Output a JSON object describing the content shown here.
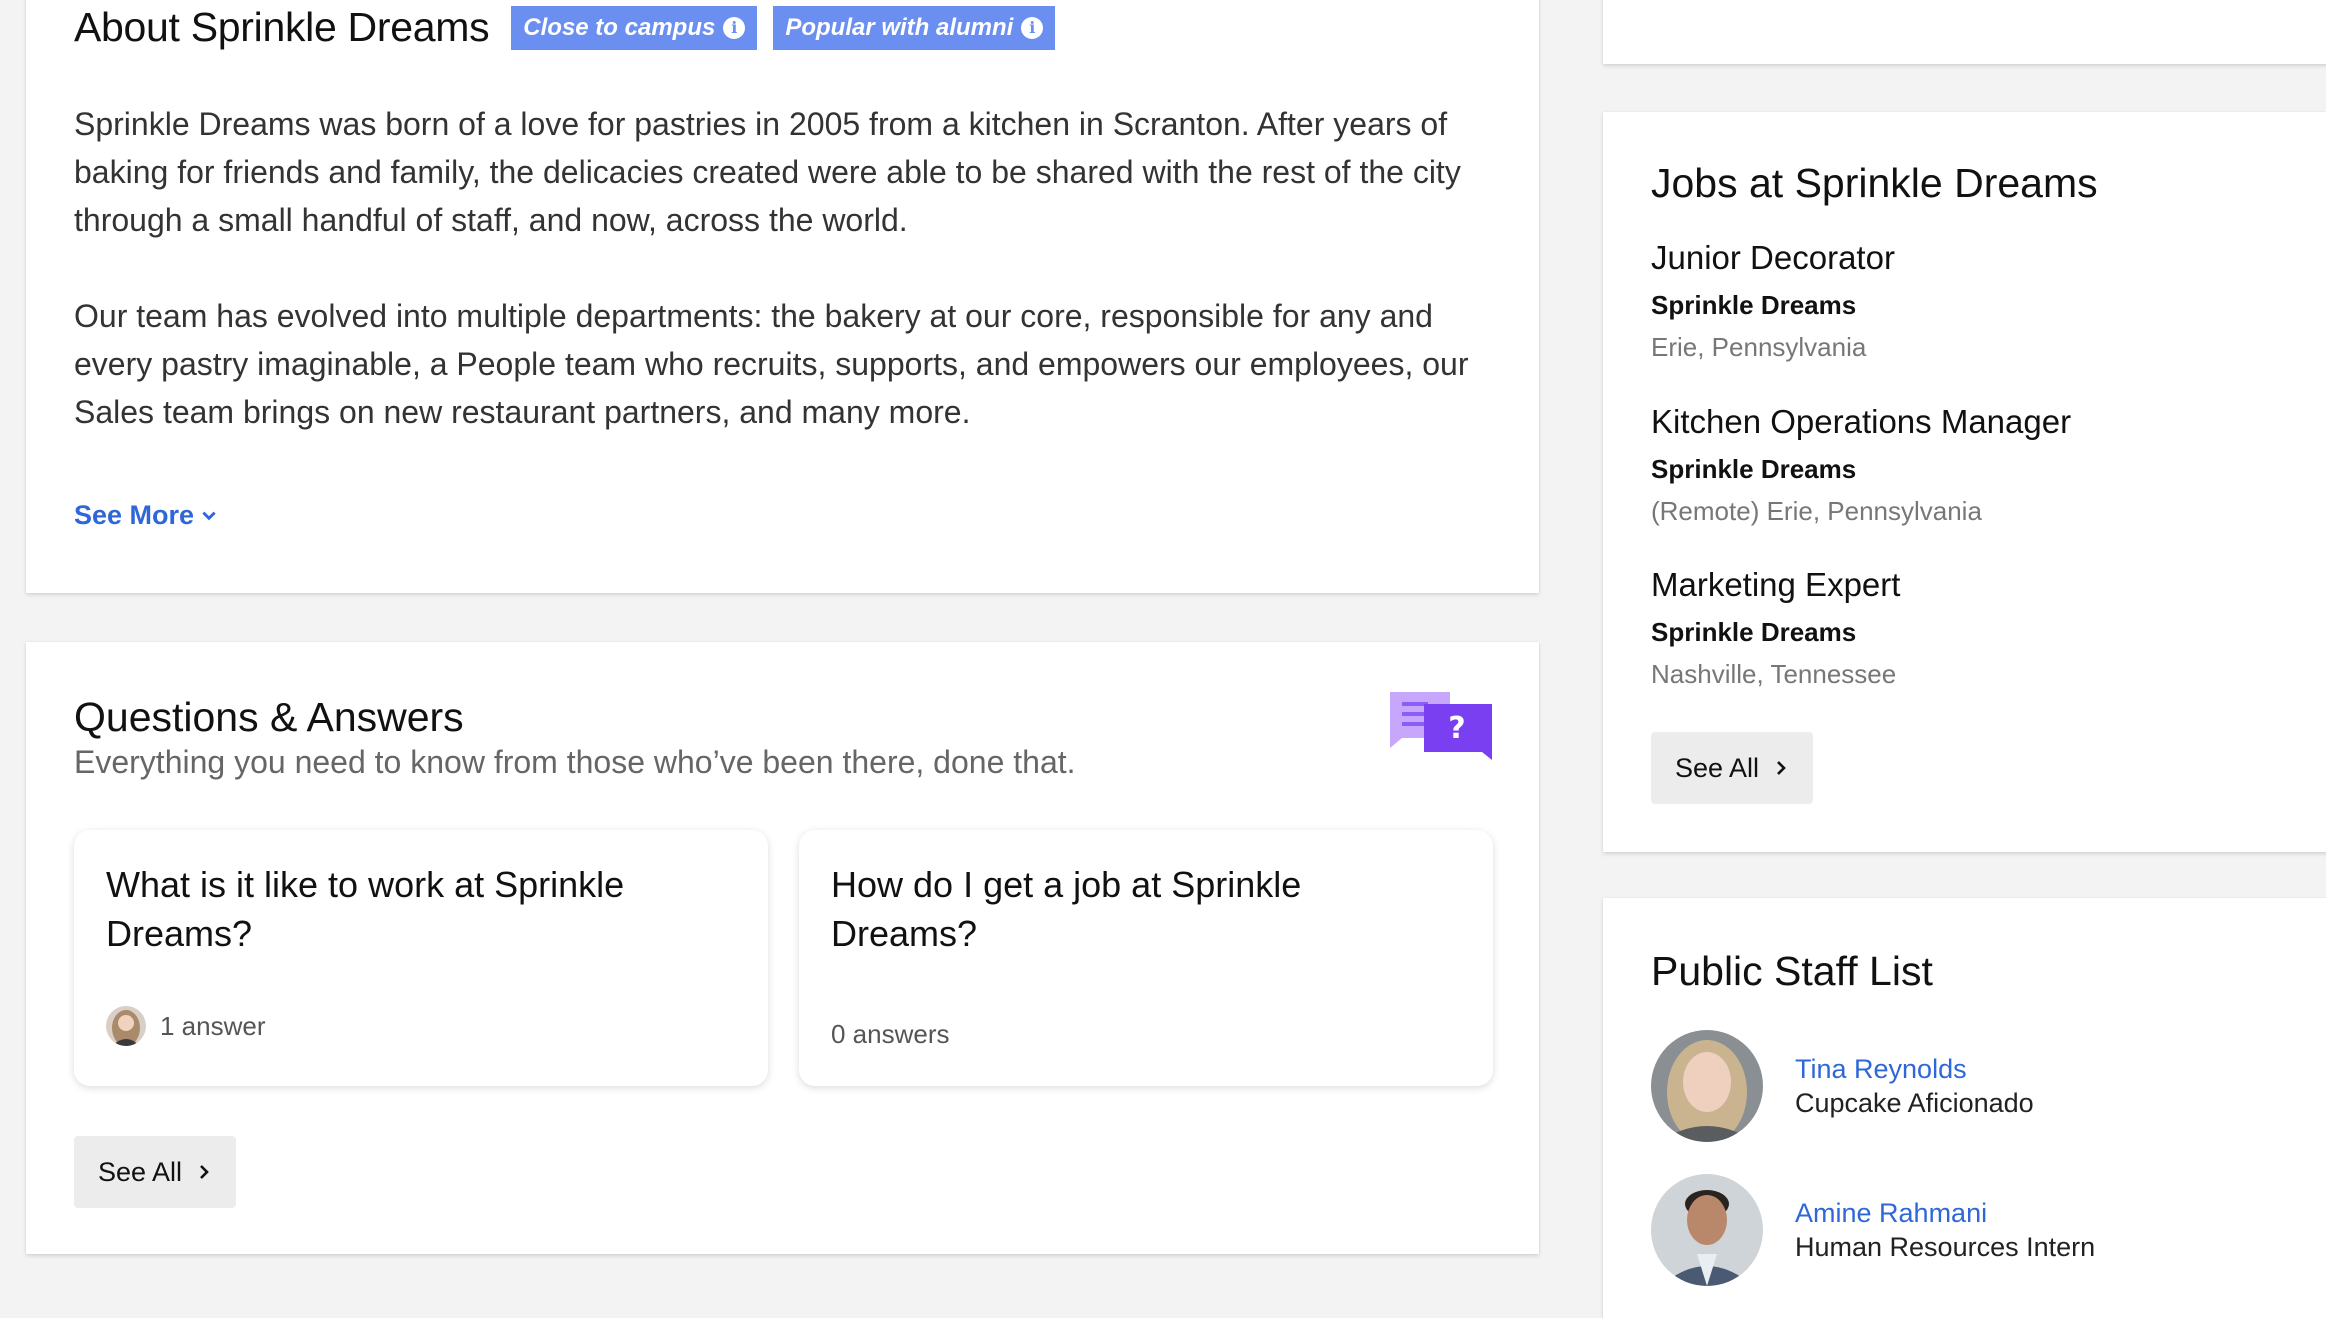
{
  "about": {
    "title": "About Sprinkle Dreams",
    "badges": [
      "Close to campus",
      "Popular with alumni"
    ],
    "paragraphs": [
      "Sprinkle Dreams was born of a love for pastries in 2005 from a kitchen in Scranton. After years of baking for friends and family, the delicacies created were able to be shared with the rest of the city through a small handful of staff, and now, across the world.",
      "Our team has evolved into multiple departments: the bakery at our core, responsible for any and every pastry imaginable, a People team who recruits, supports, and empowers our employees, our Sales team brings on new restaurant partners, and many more."
    ],
    "see_more": "See More"
  },
  "qa": {
    "title": "Questions & Answers",
    "subtitle": "Everything you need to know from those who’ve been there, done that.",
    "questions": [
      {
        "question": "What is it like to work at Sprinkle Dreams?",
        "answers": "1 answer"
      },
      {
        "question": "How do I get a job at Sprinkle Dreams?",
        "answers": "0 answers"
      }
    ],
    "see_all": "See All"
  },
  "jobs": {
    "title": "Jobs at Sprinkle Dreams",
    "items": [
      {
        "title": "Junior Decorator",
        "company": "Sprinkle Dreams",
        "location": "Erie, Pennsylvania"
      },
      {
        "title": "Kitchen Operations Manager",
        "company": "Sprinkle Dreams",
        "location": "(Remote) Erie, Pennsylvania"
      },
      {
        "title": "Marketing Expert",
        "company": "Sprinkle Dreams",
        "location": "Nashville, Tennessee"
      }
    ],
    "see_all": "See All"
  },
  "staff": {
    "title": "Public Staff List",
    "people": [
      {
        "name": "Tina Reynolds",
        "role": "Cupcake Aficionado"
      },
      {
        "name": "Amine Rahmani",
        "role": "Human Resources Intern"
      }
    ]
  },
  "colors": {
    "badge": "#6b8ff0",
    "link": "#2f67d8",
    "qa_icon": "#7b3ff2"
  }
}
